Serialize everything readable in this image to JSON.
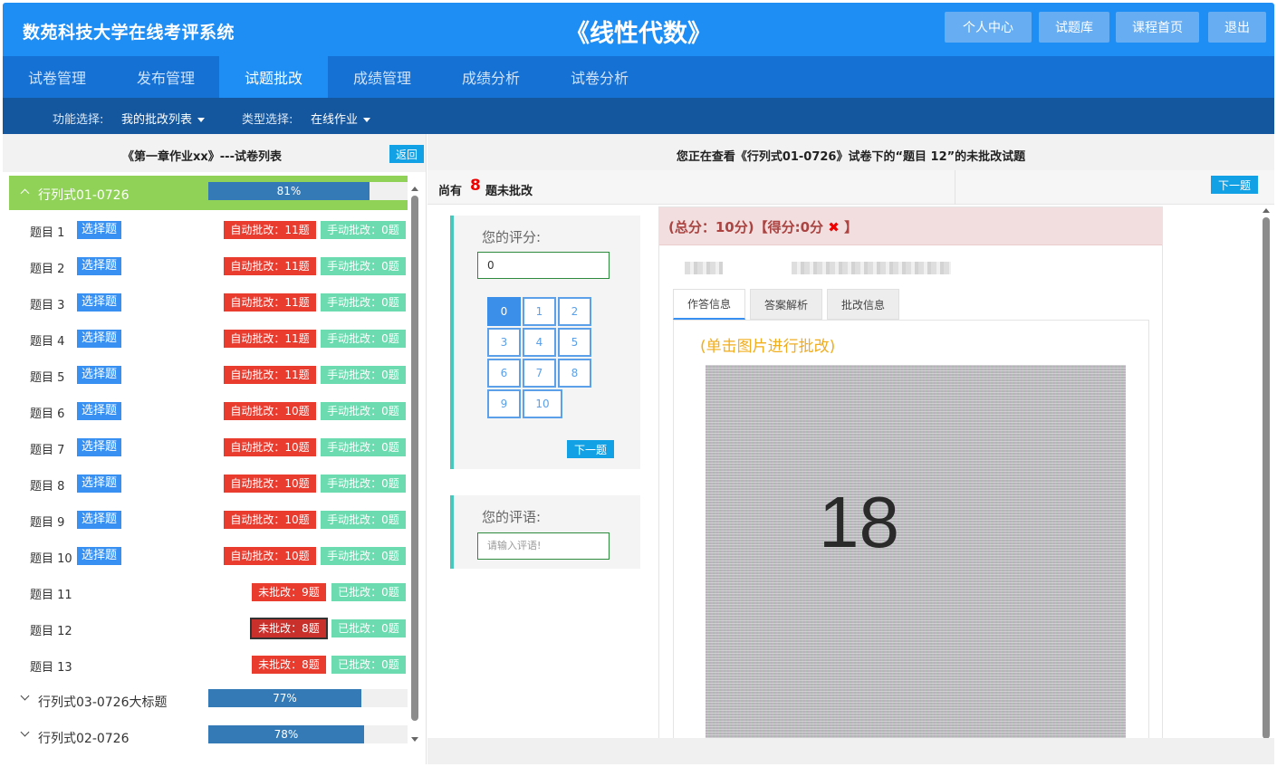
{
  "header": {
    "brand": "数苑科技大学在线考评系统",
    "course": "《线性代数》",
    "buttons": [
      "个人中心",
      "试题库",
      "课程首页",
      "退出"
    ]
  },
  "nav": {
    "items": [
      "试卷管理",
      "发布管理",
      "试题批改",
      "成绩管理",
      "成绩分析",
      "试卷分析"
    ],
    "active": "试题批改"
  },
  "filters": {
    "function_label": "功能选择:",
    "function_value": "我的批改列表",
    "type_label": "类型选择:",
    "type_value": "在线作业"
  },
  "left_panel": {
    "title": "《第一章作业xx》---试卷列表",
    "back": "返回",
    "papers": [
      {
        "name": "行列式01-0726",
        "progress": 81,
        "progress_label": "81%",
        "expanded": true
      },
      {
        "name": "行列式03-0726大标题",
        "progress": 77,
        "progress_label": "77%",
        "expanded": false
      },
      {
        "name": "行列式02-0726",
        "progress": 78,
        "progress_label": "78%",
        "expanded": false
      }
    ],
    "questions": [
      {
        "name": "题目 1",
        "type": "选择题",
        "tag1": "自动批改：11题",
        "tag2": "手动批改：0题"
      },
      {
        "name": "题目 2",
        "type": "选择题",
        "tag1": "自动批改：11题",
        "tag2": "手动批改：0题"
      },
      {
        "name": "题目 3",
        "type": "选择题",
        "tag1": "自动批改：11题",
        "tag2": "手动批改：0题"
      },
      {
        "name": "题目 4",
        "type": "选择题",
        "tag1": "自动批改：11题",
        "tag2": "手动批改：0题"
      },
      {
        "name": "题目 5",
        "type": "选择题",
        "tag1": "自动批改：11题",
        "tag2": "手动批改：0题"
      },
      {
        "name": "题目 6",
        "type": "选择题",
        "tag1": "自动批改：10题",
        "tag2": "手动批改：0题"
      },
      {
        "name": "题目 7",
        "type": "选择题",
        "tag1": "自动批改：10题",
        "tag2": "手动批改：0题"
      },
      {
        "name": "题目 8",
        "type": "选择题",
        "tag1": "自动批改：10题",
        "tag2": "手动批改：0题"
      },
      {
        "name": "题目 9",
        "type": "选择题",
        "tag1": "自动批改：10题",
        "tag2": "手动批改：0题"
      },
      {
        "name": "题目 10",
        "type": "选择题",
        "tag1": "自动批改：10题",
        "tag2": "手动批改：0题"
      },
      {
        "name": "题目 11",
        "type": "",
        "tag1": "未批改：9题",
        "tag2": "已批改：0题"
      },
      {
        "name": "题目 12",
        "type": "",
        "tag1": "未批改：8题",
        "tag2": "已批改：0题",
        "selected": true
      },
      {
        "name": "题目 13",
        "type": "",
        "tag1": "未批改：8题",
        "tag2": "已批改：0题"
      }
    ]
  },
  "right_panel": {
    "title": "您正在查看《行列式01-0726》试卷下的“题目 12”的未批改试题",
    "remaining_prefix": "尚有",
    "remaining_count": "8",
    "remaining_suffix": "题未批改",
    "next_top": "下一题",
    "score_label": "您的评分:",
    "score_value": "0",
    "keys": [
      "0",
      "1",
      "2",
      "3",
      "4",
      "5",
      "6",
      "7",
      "8",
      "9",
      "10"
    ],
    "selected_key": "0",
    "next_btn": "下一题",
    "comment_label": "您的评语:",
    "comment_placeholder": "请输入评语!",
    "score_header": "(总分：10分)【得分:0分",
    "score_header_mark": "✖",
    "score_header_end": "】",
    "tabs": [
      "作答信息",
      "答案解析",
      "批改信息"
    ],
    "hint": "(单击图片进行批改)",
    "photo_text": "18"
  },
  "colors": {
    "header_bg": "#1e8ef5",
    "nav_bg": "#1671d5",
    "subbar_bg": "#14579f",
    "active_paper": "#8fd257",
    "tag_red": "#ea3b2f",
    "tag_green": "#6cdcb0"
  }
}
